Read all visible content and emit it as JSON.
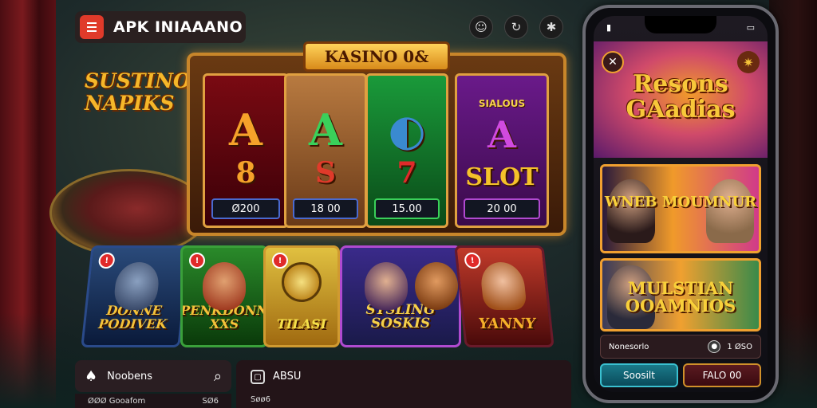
{
  "header": {
    "app_title": "APK INIAAANO",
    "menu_icon": "hamburger-icon",
    "icons": [
      "smile-icon",
      "refresh-icon",
      "star-icon"
    ]
  },
  "side_banner": "SUSTINO NAPIKS",
  "slot": {
    "title": "KASINO 0&",
    "reels": [
      {
        "symbol": "A",
        "symbol2": "8",
        "tag": "Ø200"
      },
      {
        "symbol": "A",
        "symbol2": "S",
        "tag": "18 00"
      },
      {
        "symbol": "◐",
        "symbol2": "7",
        "tag": "15.00"
      },
      {
        "symbol": "A",
        "symbol2": "SLOT",
        "label": "SIALOUS",
        "tag": "20 00"
      }
    ]
  },
  "cards": [
    {
      "title": "DONNE PODIVEK",
      "badge": "!"
    },
    {
      "title": "PENKDONN XXS",
      "badge": "!"
    },
    {
      "title": "TILASI",
      "badge": "!"
    },
    {
      "title": "STSLING SOSKIS",
      "badge": ""
    },
    {
      "title": "YANNY",
      "badge": "!"
    }
  ],
  "search_bar": {
    "label": "Noobens",
    "left_icon": "cards-icon",
    "search_icon": "search-icon"
  },
  "bottom_row": {
    "left": "ØØØ Gooafom",
    "right": "SØ6"
  },
  "aux": {
    "label": "ABSU",
    "sub": "Søø6"
  },
  "phone": {
    "hero_title": "Resons GAadias",
    "card1_title": "WNEB MOUMNUR",
    "card2_title": "MULSTIAN OOAMNIOS",
    "info_label": "Nonesorlo",
    "info_value": "1 ØSO",
    "btn1": "Soosilt",
    "btn2": "FALO 00"
  },
  "colors": {
    "accent": "#e03a2a",
    "gold": "#f5c23a",
    "frame": "#c8862a"
  }
}
